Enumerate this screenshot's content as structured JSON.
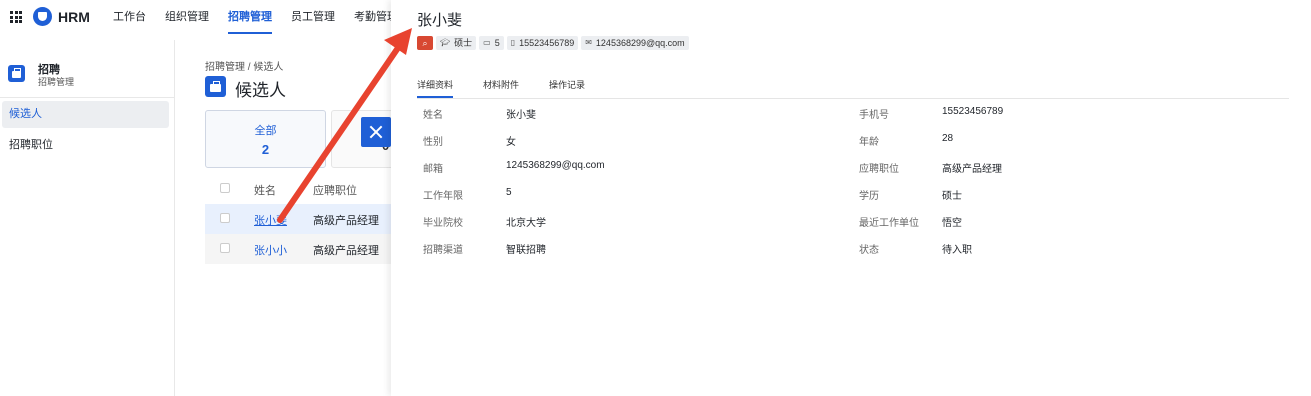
{
  "app": {
    "brand": "HRM"
  },
  "topnav": [
    "工作台",
    "组织管理",
    "招聘管理",
    "员工管理",
    "考勤管理"
  ],
  "sidebar": {
    "title": "招聘",
    "subtitle": "招聘管理",
    "items": [
      "候选人",
      "招聘职位"
    ]
  },
  "main": {
    "breadcrumb": "招聘管理 / 候选人",
    "page_title": "候选人",
    "stats": [
      {
        "label": "全部",
        "value": "2"
      },
      {
        "label": "",
        "value": "0"
      }
    ],
    "table": {
      "headers": [
        "姓名",
        "应聘职位"
      ],
      "rows": [
        {
          "name": "张小斐",
          "position": "高级产品经理"
        },
        {
          "name": "张小小",
          "position": "高级产品经理"
        }
      ]
    }
  },
  "drawer": {
    "title": "张小斐",
    "tags": {
      "degree": "硕士",
      "years": "5",
      "phone": "15523456789",
      "email": "1245368299@qq.com"
    },
    "tabs": [
      "详细资料",
      "材料附件",
      "操作记录"
    ],
    "fields_left": [
      {
        "label": "姓名",
        "value": "张小斐"
      },
      {
        "label": "性别",
        "value": "女"
      },
      {
        "label": "邮箱",
        "value": "1245368299@qq.com"
      },
      {
        "label": "工作年限",
        "value": "5"
      },
      {
        "label": "毕业院校",
        "value": "北京大学"
      },
      {
        "label": "招聘渠道",
        "value": "智联招聘"
      }
    ],
    "fields_right": [
      {
        "label": "手机号",
        "value": "15523456789"
      },
      {
        "label": "年龄",
        "value": "28"
      },
      {
        "label": "应聘职位",
        "value": "高级产品经理"
      },
      {
        "label": "学历",
        "value": "硕士"
      },
      {
        "label": "最近工作单位",
        "value": "悟空"
      },
      {
        "label": "状态",
        "value": "待入职"
      }
    ]
  },
  "colors": {
    "accent": "#1f5fd6",
    "annotation_arrow": "#e8432f",
    "tag_red": "#d84832"
  }
}
